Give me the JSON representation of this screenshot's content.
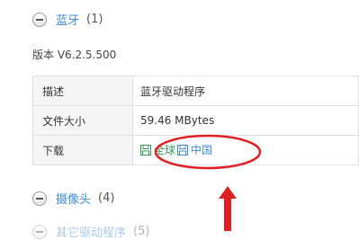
{
  "sections": [
    {
      "title": "蓝牙",
      "count": "(1)"
    },
    {
      "title": "摄像头",
      "count": "(4)"
    },
    {
      "title": "其它驱动程序",
      "count": "(5)"
    }
  ],
  "version": "版本 V6.2.5.500",
  "table": {
    "rows": [
      {
        "key": "描述",
        "value": "蓝牙驱动程序"
      },
      {
        "key": "文件大小",
        "value": "59.46 MBytes"
      },
      {
        "key": "下载",
        "value": ""
      }
    ],
    "downloads": [
      "全球",
      "中国"
    ]
  },
  "colors": {
    "link_blue": "#3d8bd4",
    "link_green": "#3a9a5a",
    "annotation_red": "#e02020"
  },
  "icons": [
    "minus-circle-icon",
    "save-icon"
  ]
}
